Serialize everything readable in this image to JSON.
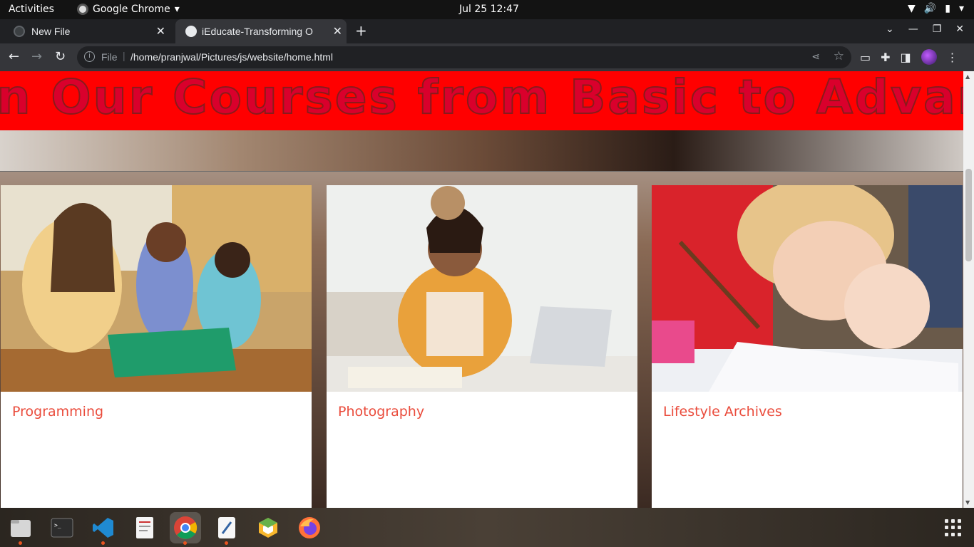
{
  "system_bar": {
    "activities": "Activities",
    "app_name": "Google Chrome",
    "clock": "Jul 25  12:47"
  },
  "browser": {
    "tabs": [
      {
        "label": "New File",
        "active": false
      },
      {
        "label": "iEducate-Transforming O",
        "active": true
      }
    ],
    "address": {
      "scheme_label": "File",
      "url": "/home/pranjwal/Pictures/js/website/home.html"
    }
  },
  "page": {
    "marquee_text": "rn Our Courses from Basic to Advanc",
    "cards": [
      {
        "title": "Programming",
        "image": "students-studying-classroom-photo"
      },
      {
        "title": "Photography",
        "image": "woman-with-laptop-studying-photo"
      },
      {
        "title": "Lifestyle Archives",
        "image": "children-drawing-photo"
      }
    ]
  },
  "dock": {
    "items": [
      "files-icon",
      "terminal-icon",
      "vscode-icon",
      "text-editor-icon",
      "chrome-icon",
      "gedit-icon",
      "app-cube-icon",
      "firefox-icon"
    ],
    "active_item": "chrome-icon"
  },
  "colors": {
    "marquee_bg": "#ff0000",
    "marquee_text": "#d9002c",
    "card_title": "#ea4c3c",
    "browser_bg": "#35363a"
  }
}
